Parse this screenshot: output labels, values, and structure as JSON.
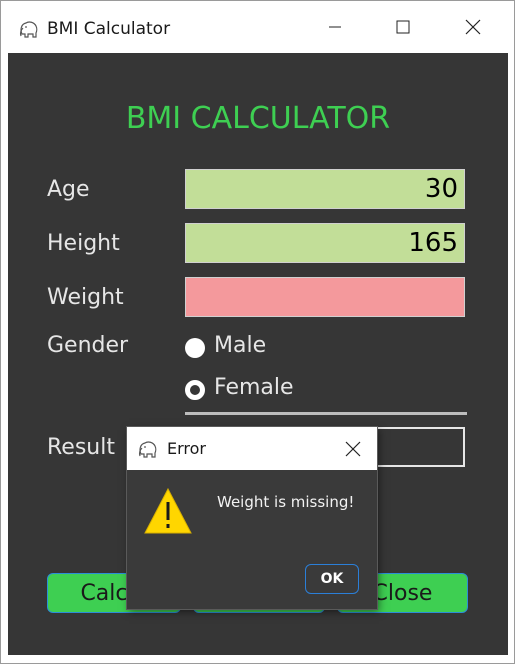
{
  "window": {
    "title": "BMI Calculator",
    "icon": "elephant-icon",
    "controls": [
      "minimize-icon",
      "maximize-icon",
      "close-icon"
    ]
  },
  "form": {
    "heading": "BMI CALCULATOR",
    "age": {
      "label": "Age",
      "value": "30"
    },
    "height": {
      "label": "Height",
      "value": "165"
    },
    "weight": {
      "label": "Weight",
      "value": ""
    },
    "gender": {
      "label": "Gender",
      "options": [
        "Male",
        "Female"
      ],
      "selected": "Female"
    },
    "result": {
      "label": "Result",
      "value": ""
    }
  },
  "buttons": {
    "calculate": "Calcul",
    "close": "Close"
  },
  "dialog": {
    "title": "Error",
    "message": "Weight is missing!",
    "ok": "OK",
    "icon": "warning-icon"
  },
  "colors": {
    "heading": "#3ecf52",
    "valid_field": "#c2de98",
    "invalid_field": "#f4999c",
    "button": "#3ecf52",
    "background": "#363636"
  }
}
